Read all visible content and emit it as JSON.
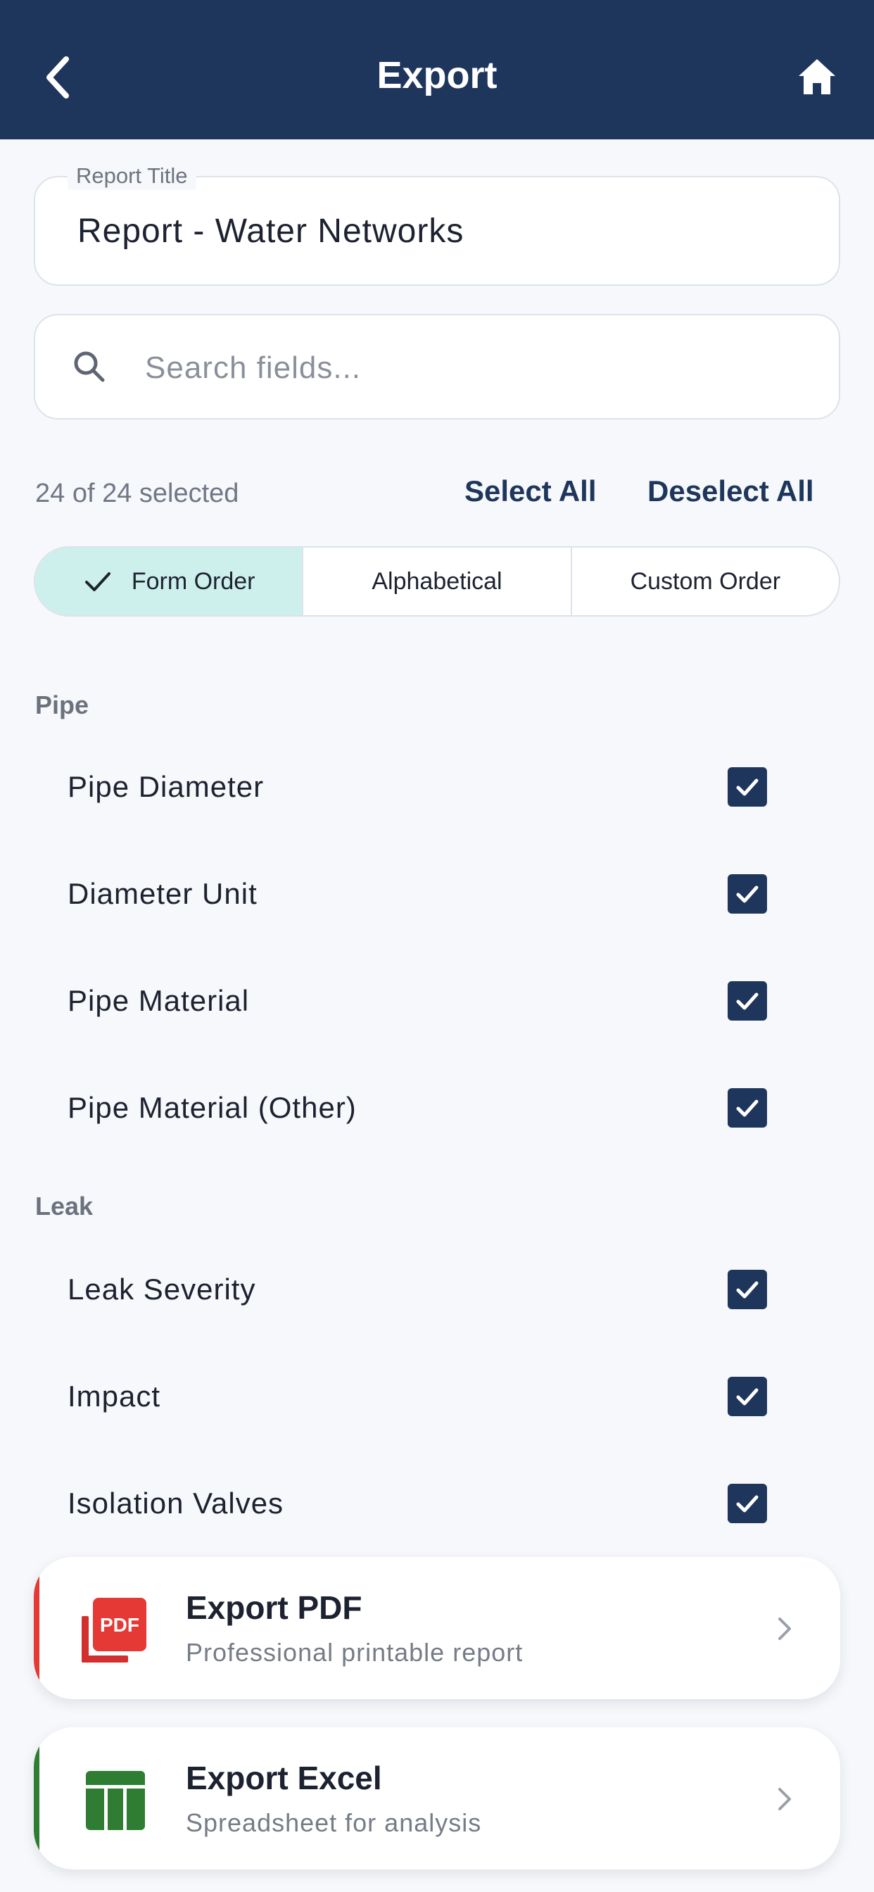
{
  "header": {
    "title": "Export",
    "back_icon": "chevron-left-icon",
    "home_icon": "home-icon"
  },
  "report_title": {
    "label": "Report Title",
    "value": "Report - Water Networks"
  },
  "search": {
    "placeholder": "Search fields...",
    "icon": "search-icon"
  },
  "selection": {
    "count_text": "24 of 24 selected",
    "select_all": "Select All",
    "deselect_all": "Deselect All"
  },
  "sort_tabs": [
    {
      "label": "Form Order",
      "active": true
    },
    {
      "label": "Alphabetical",
      "active": false
    },
    {
      "label": "Custom Order",
      "active": false
    }
  ],
  "sections": [
    {
      "title": "Pipe",
      "fields": [
        {
          "label": "Pipe Diameter",
          "checked": true
        },
        {
          "label": "Diameter Unit",
          "checked": true
        },
        {
          "label": "Pipe Material",
          "checked": true
        },
        {
          "label": "Pipe Material (Other)",
          "checked": true
        }
      ]
    },
    {
      "title": "Leak",
      "fields": [
        {
          "label": "Leak Severity",
          "checked": true
        },
        {
          "label": "Impact",
          "checked": true
        },
        {
          "label": "Isolation Valves",
          "checked": true
        }
      ]
    }
  ],
  "export_options": [
    {
      "title": "Export PDF",
      "subtitle": "Professional printable report",
      "icon": "pdf-icon",
      "accent": "#e53935"
    },
    {
      "title": "Export Excel",
      "subtitle": "Spreadsheet for analysis",
      "icon": "spreadsheet-icon",
      "accent": "#2e7d32"
    }
  ],
  "colors": {
    "header": "#1f365c",
    "active_tab": "#cdf0ec",
    "checkbox": "#1f365c"
  }
}
